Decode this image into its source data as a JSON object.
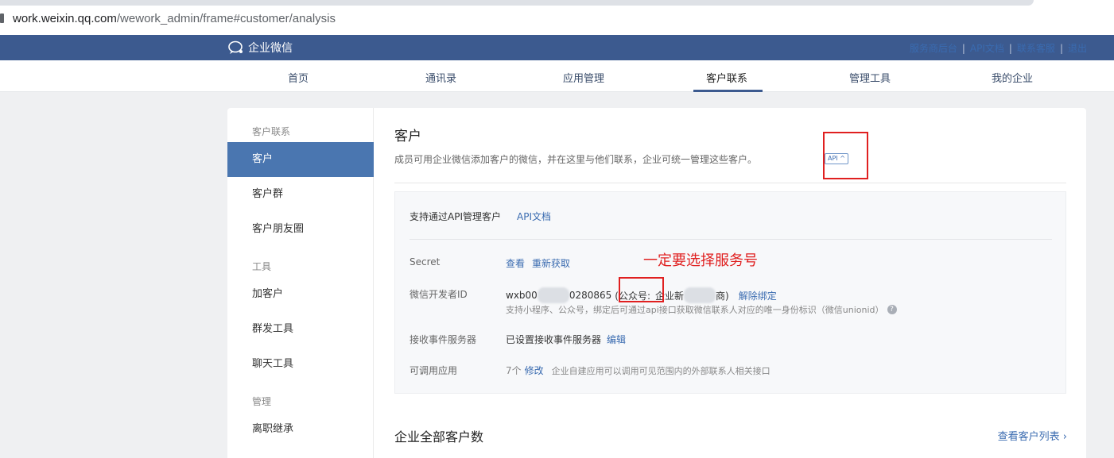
{
  "browser": {
    "url_host": "work.weixin.qq.com",
    "url_path": "/wework_admin/frame#customer/analysis"
  },
  "header": {
    "logo_text": "企业微信",
    "links": [
      "服务商后台",
      "API文档",
      "联系客服",
      "退出"
    ]
  },
  "nav": {
    "items": [
      "首页",
      "通讯录",
      "应用管理",
      "客户联系",
      "管理工具",
      "我的企业"
    ],
    "active": "客户联系"
  },
  "sidebar": {
    "group1": "客户联系",
    "group1_items": [
      "客户",
      "客户群",
      "客户朋友圈"
    ],
    "group2": "工具",
    "group2_items": [
      "加客户",
      "群发工具",
      "聊天工具"
    ],
    "group3": "管理",
    "group3_items": [
      "离职继承"
    ],
    "active": "客户"
  },
  "main": {
    "title": "客户",
    "description": "成员可用企业微信添加客户的微信，并在这里与他们联系，企业可统一管理这些客户。",
    "api_badge": "API ^",
    "api_panel": {
      "title": "支持通过API管理客户",
      "doc_link": "API文档",
      "secret_label": "Secret",
      "secret_view": "查看",
      "secret_refresh": "重新获取",
      "dev_id_label": "微信开发者ID",
      "dev_id_prefix": "wxb00",
      "dev_id_suffix": "0280865",
      "account_type": "(公众号:",
      "account_name_prefix": "企业新",
      "account_name_suffix": "商)",
      "unbind": "解除绑定",
      "dev_id_hint": "支持小程序、公众号，绑定后可通过api接口获取微信联系人对应的唯一身份标识（微信unionid）",
      "event_label": "接收事件服务器",
      "event_value": "已设置接收事件服务器",
      "event_edit": "编辑",
      "apps_label": "可调用应用",
      "apps_count": "7个",
      "apps_edit": "修改",
      "apps_hint": "企业自建应用可以调用可见范围内的外部联系人相关接口"
    },
    "annotation": "一定要选择服务号",
    "total_title": "企业全部客户数",
    "view_list": "查看客户列表 ›"
  },
  "colors": {
    "header_bg": "#3c5a8f",
    "active_sidebar": "#4a76b0",
    "link": "#3a6bb0",
    "annotation": "#e02020"
  }
}
